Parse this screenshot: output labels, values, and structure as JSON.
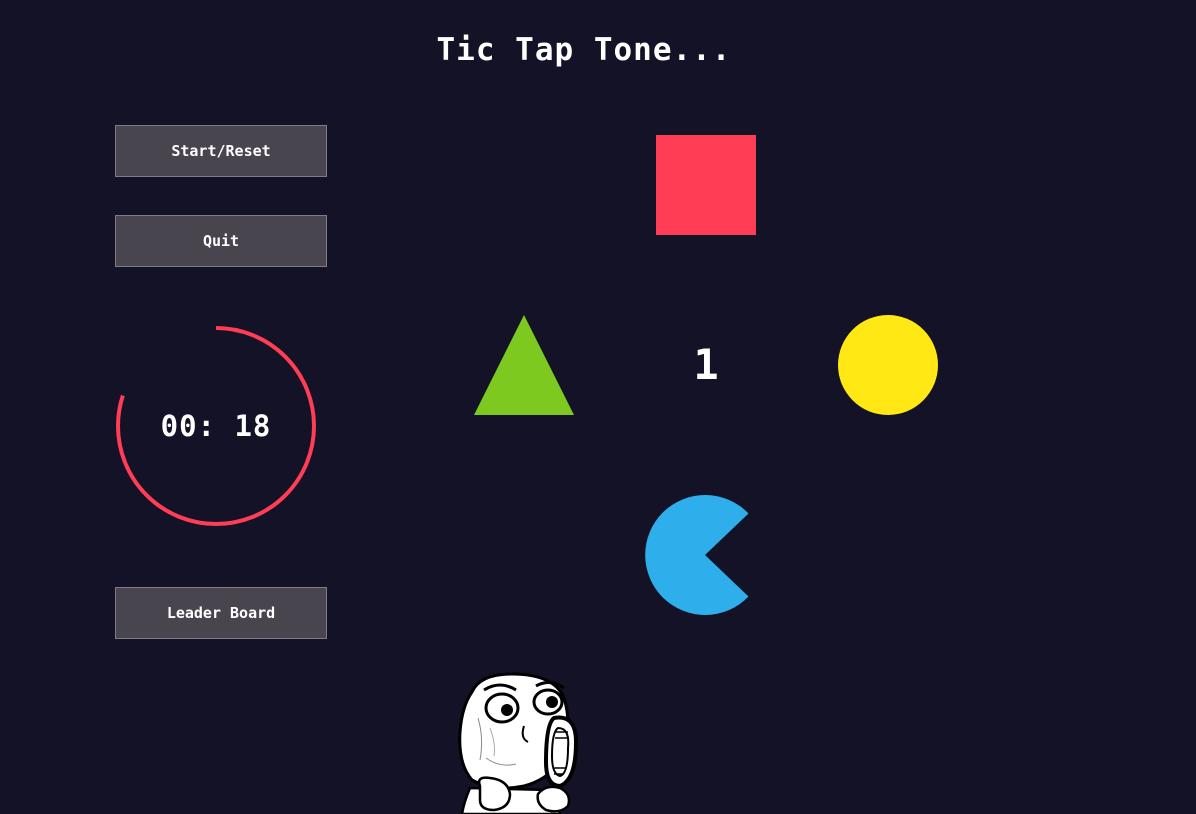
{
  "title": "Tic Tap Tone...",
  "buttons": {
    "start_reset": "Start/Reset",
    "quit": "Quit",
    "leader_board": "Leader Board"
  },
  "timer": {
    "display": "00: 18",
    "remaining_fraction": 0.8,
    "ring_color": "#ff3d55"
  },
  "game": {
    "center_number": "1",
    "shapes": [
      {
        "name": "square",
        "color": "#ff3d55"
      },
      {
        "name": "triangle",
        "color": "#7ec91f"
      },
      {
        "name": "circle",
        "color": "#ffe813"
      },
      {
        "name": "pacman",
        "color": "#2eaeea"
      }
    ]
  },
  "colors": {
    "background": "#141226",
    "button_bg": "#48454f",
    "button_border": "#7f7b88"
  },
  "character_icon": "rage-comic-face-icon"
}
